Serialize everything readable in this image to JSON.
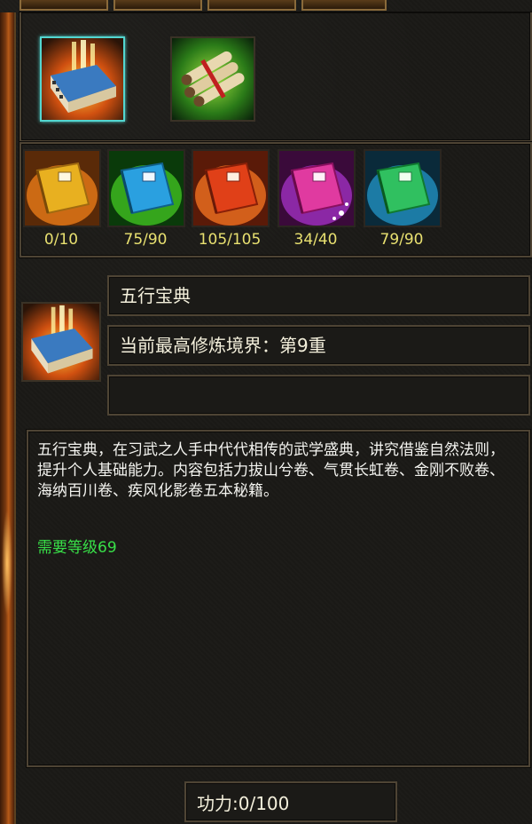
{
  "colors": {
    "background": "#1a1916",
    "frame": "#4e4434",
    "selected_border": "#53d6d0",
    "count_text": "#e8e070",
    "requirement_text": "#38e048",
    "body_text": "#f4f4f0"
  },
  "top_items": [
    {
      "icon": "treasure-book-icon",
      "selected": true
    },
    {
      "icon": "scroll-bundle-icon",
      "selected": false
    }
  ],
  "books": [
    {
      "icon": "gold-book-icon",
      "color": "#e8a020",
      "count": "0/10"
    },
    {
      "icon": "blue-book-icon",
      "color": "#2aa0e0",
      "count": "75/90"
    },
    {
      "icon": "red-book-icon",
      "color": "#e04018",
      "count": "105/105"
    },
    {
      "icon": "pink-book-icon",
      "color": "#e03aa0",
      "count": "34/40"
    },
    {
      "icon": "green-book-icon",
      "color": "#30c060",
      "count": "79/90"
    }
  ],
  "detail": {
    "icon": "treasure-book-icon",
    "name": "五行宝典",
    "realm": "当前最高修炼境界：第9重",
    "extra": ""
  },
  "description": {
    "text": "五行宝典，在习武之人手中代代相传的武学盛典，讲究借鉴自然法则，提升个人基础能力。内容包括力拔山兮卷、气贯长虹卷、金刚不败卷、海纳百川卷、疾风化影卷五本秘籍。",
    "requirement": "需要等级69"
  },
  "power": "功力:0/100"
}
